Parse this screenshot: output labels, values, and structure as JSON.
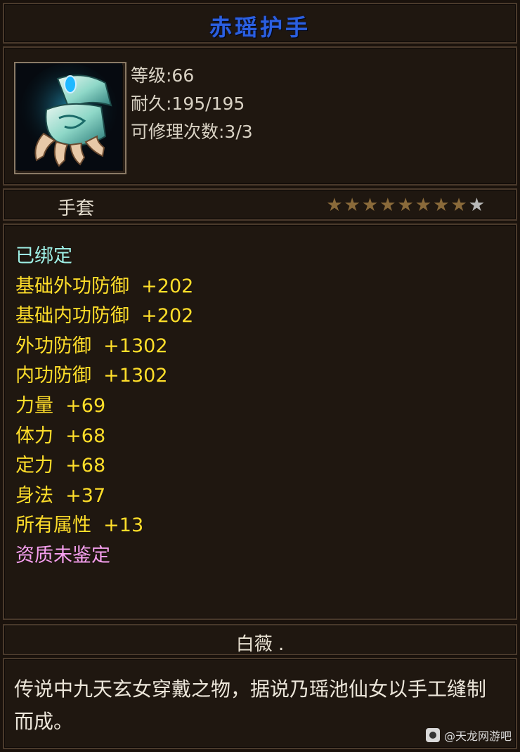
{
  "item": {
    "name": "赤瑶护手",
    "name_color": "#2b5fe0",
    "icon": "gauntlet-icon",
    "level_line": "等级:66",
    "durability_line": "耐久:195/195",
    "repair_line": "可修理次数:3/3",
    "type": "手套",
    "stars": {
      "total": 9,
      "filled": 8,
      "filled_color": "#8a6a3a",
      "empty_color": "#b8b8b8"
    }
  },
  "attributes": [
    {
      "text": "已绑定",
      "color": "#9ff0e6"
    },
    {
      "text": "基础外功防御  +202",
      "color": "#ffde2a"
    },
    {
      "text": "基础内功防御  +202",
      "color": "#ffde2a"
    },
    {
      "text": "外功防御  +1302",
      "color": "#ffde2a"
    },
    {
      "text": "内功防御  +1302",
      "color": "#ffde2a"
    },
    {
      "text": "力量  +69",
      "color": "#ffde2a"
    },
    {
      "text": "体力  +68",
      "color": "#ffde2a"
    },
    {
      "text": "定力  +68",
      "color": "#ffde2a"
    },
    {
      "text": "身法  +37",
      "color": "#ffde2a"
    },
    {
      "text": "所有属性  +13",
      "color": "#ffde2a"
    },
    {
      "text": "资质未鉴定",
      "color": "#f7a0f0"
    }
  ],
  "description": {
    "title": "白薇 .",
    "text": "传说中九天玄女穿戴之物，据说乃瑶池仙女以手工缝制而成。"
  },
  "watermark": "@天龙网游吧"
}
